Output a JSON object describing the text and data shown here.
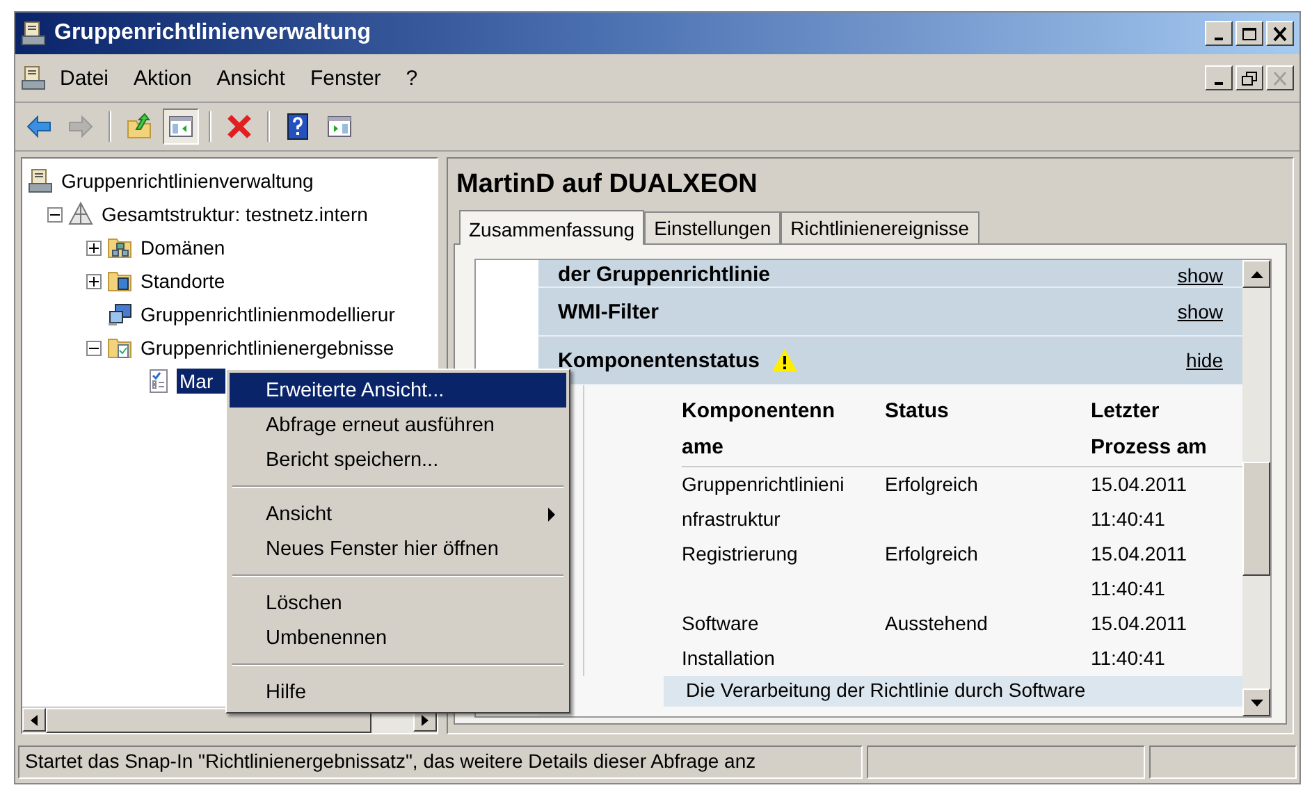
{
  "window": {
    "title": "Gruppenrichtlinienverwaltung"
  },
  "menu": [
    {
      "label": "Datei"
    },
    {
      "label": "Aktion"
    },
    {
      "label": "Ansicht"
    },
    {
      "label": "Fenster"
    },
    {
      "label": "?"
    }
  ],
  "toolbar": [
    {
      "kind": "back",
      "disabled": false
    },
    {
      "kind": "forward",
      "disabled": true
    },
    {
      "kind": "separator"
    },
    {
      "kind": "up",
      "disabled": false
    },
    {
      "kind": "tree-toggle",
      "disabled": false,
      "pressed": true
    },
    {
      "kind": "separator"
    },
    {
      "kind": "delete",
      "disabled": false
    },
    {
      "kind": "separator"
    },
    {
      "kind": "help",
      "disabled": false
    },
    {
      "kind": "action-pane",
      "disabled": false,
      "pressed": false
    }
  ],
  "tree": [
    {
      "kind": "console",
      "label": "Gruppenrichtlinienverwaltung",
      "selected": false,
      "children": [
        {
          "kind": "forest",
          "label": "Gesamtstruktur: testnetz.intern",
          "selected": false,
          "expanded": true,
          "children": [
            {
              "kind": "domains",
              "label": "Domänen",
              "selected": false,
              "expanded": false
            },
            {
              "kind": "sites",
              "label": "Standorte",
              "selected": false,
              "expanded": false
            },
            {
              "kind": "modeling",
              "label": "Gruppenrichtlinienmodellierur",
              "selected": false
            },
            {
              "kind": "results",
              "label": "Gruppenrichtlinienergebnisse",
              "selected": false,
              "expanded": true,
              "children": [
                {
                  "kind": "report",
                  "label": "Mar",
                  "selected": true
                }
              ]
            }
          ]
        }
      ]
    }
  ],
  "details": {
    "title": "MartinD auf DUALXEON",
    "tabs": [
      {
        "label": "Zusammenfassung",
        "selected": true
      },
      {
        "label": "Einstellungen",
        "selected": false
      },
      {
        "label": "Richtlinienereignisse",
        "selected": false
      }
    ],
    "sections": [
      {
        "title": "der Gruppenrichtlinie",
        "link": "show",
        "warning": false
      },
      {
        "title": "WMI-Filter",
        "link": "show",
        "warning": false
      },
      {
        "title": "Komponentenstatus",
        "link": "hide",
        "warning": true
      }
    ],
    "table": {
      "columns": [
        "Komponentenn\name",
        "Status",
        "Letzter\nProzess am"
      ],
      "rows": [
        [
          "Gruppenrichtlinieni\nnfrastruktur",
          "Erfolgreich",
          "15.04.2011\n11:40:41"
        ],
        [
          "Registrierung",
          "Erfolgreich",
          "15.04.2011\n11:40:41"
        ],
        [
          "Software\nInstallation",
          "Ausstehend",
          "15.04.2011\n11:40:41"
        ]
      ]
    },
    "note": "Die Verarbeitung der Richtlinie durch Software"
  },
  "context_menu": [
    {
      "kind": "item",
      "label": "Erweiterte Ansicht...",
      "selected": true,
      "submenu": false
    },
    {
      "kind": "item",
      "label": "Abfrage erneut ausführen",
      "selected": false,
      "submenu": false
    },
    {
      "kind": "item",
      "label": "Bericht speichern...",
      "selected": false,
      "submenu": false
    },
    {
      "kind": "separator"
    },
    {
      "kind": "item",
      "label": "Ansicht",
      "selected": false,
      "submenu": true
    },
    {
      "kind": "item",
      "label": "Neues Fenster hier öffnen",
      "selected": false,
      "submenu": false
    },
    {
      "kind": "separator"
    },
    {
      "kind": "item",
      "label": "Löschen",
      "selected": false,
      "submenu": false
    },
    {
      "kind": "item",
      "label": "Umbenennen",
      "selected": false,
      "submenu": false
    },
    {
      "kind": "separator"
    },
    {
      "kind": "item",
      "label": "Hilfe",
      "selected": false,
      "submenu": false
    }
  ],
  "status_bar": {
    "text": "Startet das Snap-In \"Richtlinienergebnissatz\", das weitere Details dieser Abfrage anz"
  }
}
